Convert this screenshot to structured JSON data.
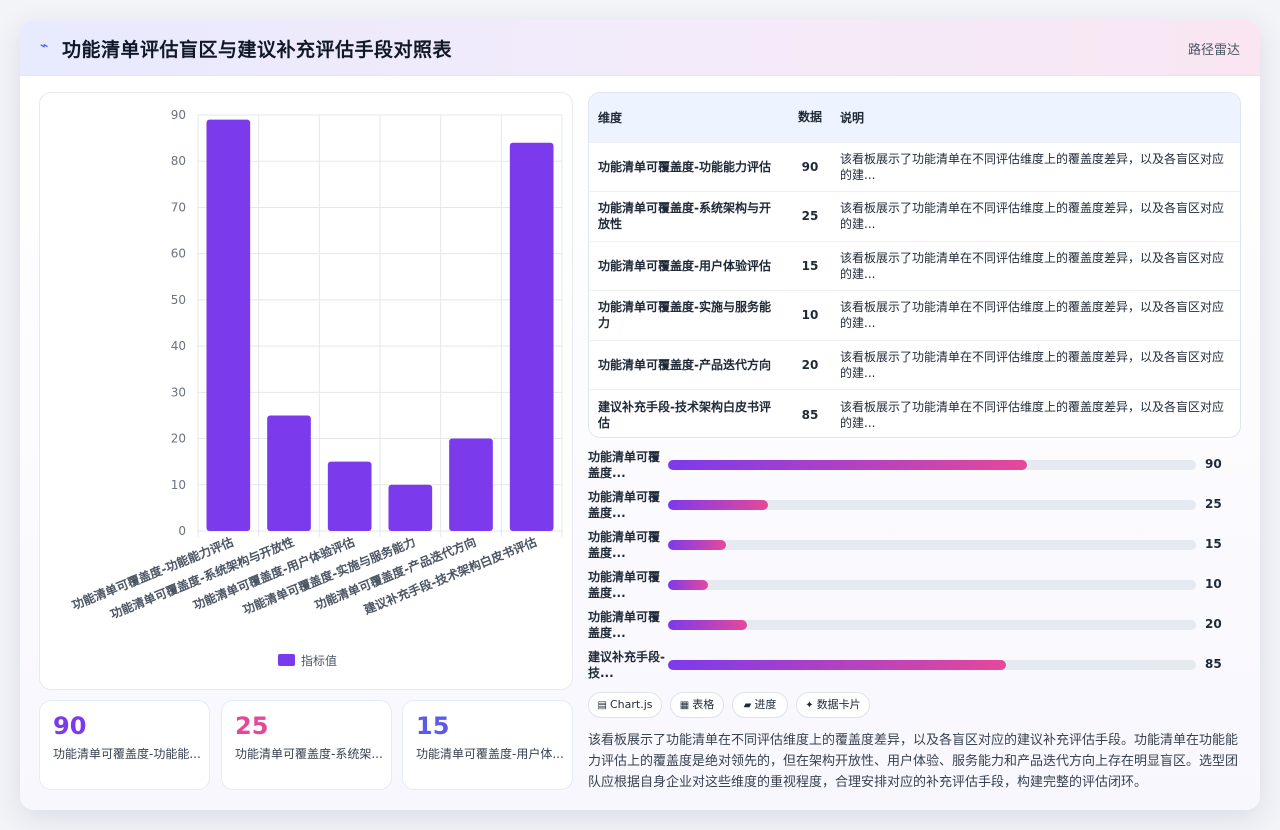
{
  "header": {
    "logo_icon": "route-icon",
    "title": "功能清单评估盲区与建议补充评估手段对照表",
    "route_label": "路径雷达"
  },
  "chart_data": {
    "type": "bar",
    "categories": [
      "功能清单可覆盖度-功能能力评估",
      "功能清单可覆盖度-系统架构与开放性",
      "功能清单可覆盖度-用户体验评估",
      "功能清单可覆盖度-实施与服务能力",
      "功能清单可覆盖度-产品迭代方向",
      "建议补充手段-技术架构白皮书评估"
    ],
    "series": [
      {
        "name": "指标值",
        "values": [
          89,
          25,
          15,
          10,
          20,
          84
        ],
        "color": "#7c3aed"
      }
    ],
    "ylim": [
      0,
      90
    ],
    "yticks": [
      0,
      10,
      20,
      30,
      40,
      50,
      60,
      70,
      80,
      90
    ],
    "grid": true,
    "legend": "bottom"
  },
  "table": {
    "headers": [
      "维度",
      "数据",
      "说明"
    ],
    "rows": [
      {
        "dim": "功能清单可覆盖度-功能能力评估",
        "value": "90",
        "desc": "该看板展示了功能清单在不同评估维度上的覆盖度差异，以及各盲区对应的建..."
      },
      {
        "dim": "功能清单可覆盖度-系统架构与开放性",
        "value": "25",
        "desc": "该看板展示了功能清单在不同评估维度上的覆盖度差异，以及各盲区对应的建..."
      },
      {
        "dim": "功能清单可覆盖度-用户体验评估",
        "value": "15",
        "desc": "该看板展示了功能清单在不同评估维度上的覆盖度差异，以及各盲区对应的建..."
      },
      {
        "dim": "功能清单可覆盖度-实施与服务能力",
        "value": "10",
        "desc": "该看板展示了功能清单在不同评估维度上的覆盖度差异，以及各盲区对应的建..."
      },
      {
        "dim": "功能清单可覆盖度-产品迭代方向",
        "value": "20",
        "desc": "该看板展示了功能清单在不同评估维度上的覆盖度差异，以及各盲区对应的建..."
      },
      {
        "dim": "建议补充手段-技术架构白皮书评估",
        "value": "85",
        "desc": "该看板展示了功能清单在不同评估维度上的覆盖度差异，以及各盲区对应的建..."
      }
    ]
  },
  "progress": [
    {
      "label": "功能清单可覆盖度...",
      "value": 90,
      "value_text": "90",
      "percent": 68
    },
    {
      "label": "功能清单可覆盖度...",
      "value": 25,
      "value_text": "25",
      "percent": 19
    },
    {
      "label": "功能清单可覆盖度...",
      "value": 15,
      "value_text": "15",
      "percent": 11
    },
    {
      "label": "功能清单可覆盖度...",
      "value": 10,
      "value_text": "10",
      "percent": 7.5
    },
    {
      "label": "功能清单可覆盖度...",
      "value": 20,
      "value_text": "20",
      "percent": 15
    },
    {
      "label": "建议补充手段-技...",
      "value": 85,
      "value_text": "85",
      "percent": 64
    }
  ],
  "stats": [
    {
      "value": "90",
      "label": "功能清单可覆盖度-功能能...",
      "color": "#7c3aed"
    },
    {
      "value": "25",
      "label": "功能清单可覆盖度-系统架...",
      "color": "#e5489a"
    },
    {
      "value": "15",
      "label": "功能清单可覆盖度-用户体...",
      "color": "#5b5ce6"
    }
  ],
  "tags": [
    {
      "icon": "▤",
      "label": "Chart.js"
    },
    {
      "icon": "▦",
      "label": "表格"
    },
    {
      "icon": "▰",
      "label": "进度"
    },
    {
      "icon": "✦",
      "label": "数据卡片"
    }
  ],
  "summary": "该看板展示了功能清单在不同评估维度上的覆盖度差异，以及各盲区对应的建议补充评估手段。功能清单在功能能力评估上的覆盖度是绝对领先的，但在架构开放性、用户体验、服务能力和产品迭代方向上存在明显盲区。选型团队应根据自身企业对这些维度的重视程度，合理安排对应的补充评估手段，构建完整的评估闭环。"
}
